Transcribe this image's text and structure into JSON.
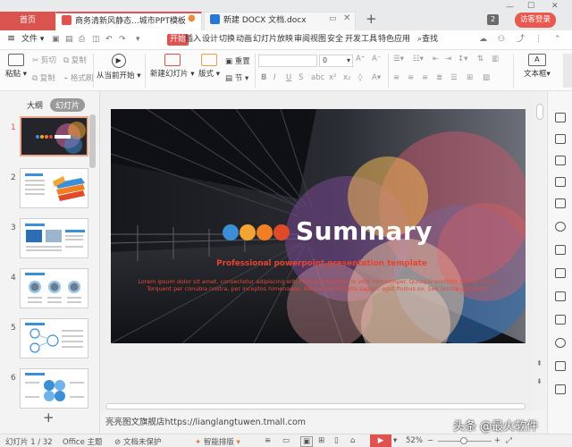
{
  "tabs": {
    "home": "首页",
    "doc1": "商务清新风静态...城市PPT模板",
    "doc2": "新建 DOCX 文档.docx",
    "count": "2",
    "login": "访客登录"
  },
  "menu": {
    "file": "文件",
    "items": [
      "开始",
      "插入",
      "设计",
      "切换",
      "动画",
      "幻灯片放映",
      "审阅",
      "视图",
      "安全",
      "开发工具",
      "特色应用"
    ],
    "search": "查找"
  },
  "ribbon": {
    "paste": "粘贴",
    "cut": "剪切",
    "copy": "复制",
    "format_painter": "格式刷",
    "play_from_current": "从当前开始",
    "new_slide": "新建幻灯片",
    "layout": "版式",
    "reset": "重置",
    "section": "节",
    "font_size": "0",
    "textbox": "文本框"
  },
  "left": {
    "outline": "大纲",
    "slides": "幻灯片",
    "slide_numbers": [
      "1",
      "2",
      "3",
      "4",
      "5",
      "6"
    ],
    "add": "+"
  },
  "slide": {
    "title": "Summary",
    "subtitle": "Professional powerpoint presentation template",
    "body": "Lorem ipsum dolor sit amet, consectetur adipiscing elit. Proin consectetur in velit non semper. Quisque porttitor ipsum ut nisl. Torquent per conubia nostra, per inceptos himenaeos. Mauris sed fringilla sapien, eget finibus ex. Sed lacinia dignissim.",
    "dot_colors": [
      "#3a8fd6",
      "#f2a533",
      "#f07f24",
      "#e0492a"
    ]
  },
  "notes": {
    "text": "亮亮图文旗舰店https://lianglangtuwen.tmall.com"
  },
  "status": {
    "slide_counter": "幻灯片 1 / 32",
    "theme": "Office 主题",
    "protect": "文档未保护",
    "smart": "智能排版",
    "zoom": "52%",
    "watermark": "头条 @最火软件"
  },
  "colors": {
    "accent": "#e0524f",
    "title_white": "#ffffff",
    "subtitle_red": "#e8432e"
  }
}
